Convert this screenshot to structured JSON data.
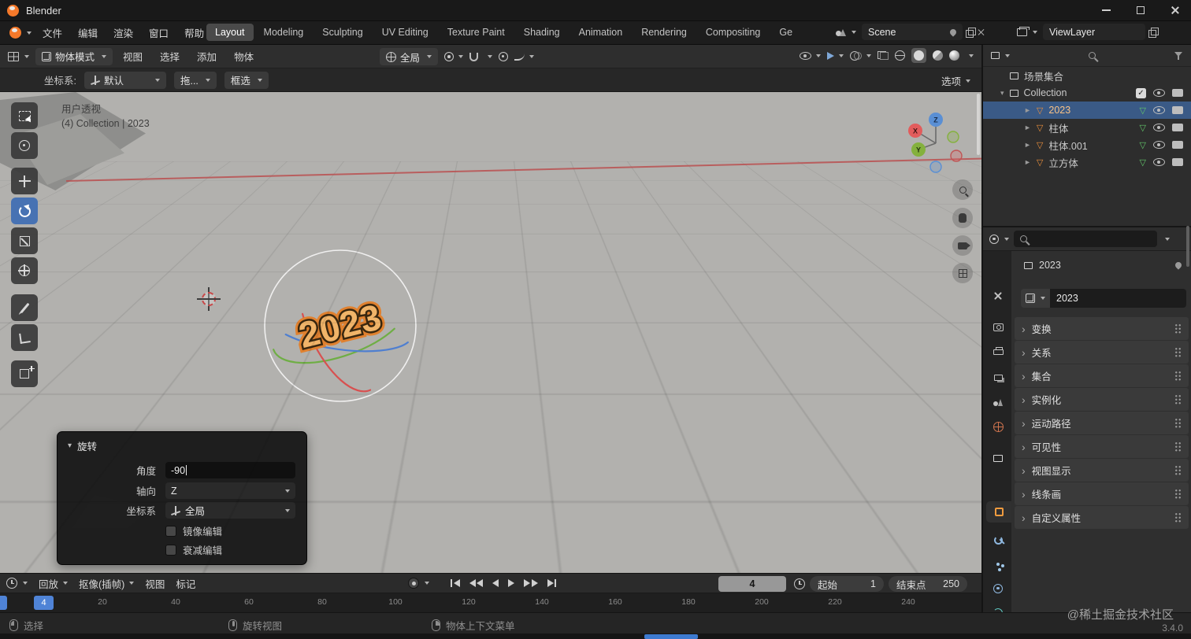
{
  "icons": {
    "mesh_tri": "▽",
    "chevron": "›",
    "collapse": "▾",
    "expand": "►"
  },
  "titlebar": {
    "title": "Blender"
  },
  "menubar": {
    "menus": [
      "文件",
      "编辑",
      "渲染",
      "窗口",
      "帮助"
    ],
    "workspaces": [
      "Layout",
      "Modeling",
      "Sculpting",
      "UV Editing",
      "Texture Paint",
      "Shading",
      "Animation",
      "Rendering",
      "Compositing",
      "Ge"
    ],
    "scene_value": "Scene",
    "viewlayer_value": "ViewLayer"
  },
  "viewport_header": {
    "mode": "物体模式",
    "menus": [
      "视图",
      "选择",
      "添加",
      "物体"
    ],
    "orientation": "全局"
  },
  "tool_header": {
    "label": "坐标系:",
    "preset": "默认",
    "drag": "拖...",
    "box_select": "框选",
    "options": "选项"
  },
  "viewport": {
    "view_label": "用户透视",
    "context_label": "(4) Collection | 2023",
    "object_text": "2023",
    "axes": {
      "x": "X",
      "y": "Y",
      "z": "Z"
    }
  },
  "rotate_panel": {
    "title": "旋转",
    "angle_label": "角度",
    "angle_value": "-90",
    "axis_label": "轴向",
    "axis_value": "Z",
    "orientation_label": "坐标系",
    "orientation_value": "全局",
    "mirror_label": "镜像编辑",
    "falloff_label": "衰减编辑"
  },
  "timeline": {
    "menus": [
      "回放",
      "抠像(插帧)",
      "视图",
      "标记"
    ],
    "current_frame": "4",
    "start_label": "起始",
    "start_value": "1",
    "end_label": "结束点",
    "end_value": "250",
    "ticks": [
      "20",
      "40",
      "60",
      "80",
      "100",
      "120",
      "140",
      "160",
      "180",
      "200",
      "220",
      "240"
    ]
  },
  "statusbar": {
    "hints": [
      "选择",
      "旋转视图",
      "物体上下文菜单"
    ],
    "watermark": "@稀土掘金技术社区",
    "version": "3.4.0"
  },
  "outliner": {
    "scene_collection": "场景集合",
    "collection": "Collection",
    "items": [
      {
        "name": "2023"
      },
      {
        "name": "柱体"
      },
      {
        "name": "柱体.001"
      },
      {
        "name": "立方体"
      }
    ]
  },
  "properties": {
    "breadcrumb": "2023",
    "object_name": "2023",
    "sections": [
      "变换",
      "关系",
      "集合",
      "实例化",
      "运动路径",
      "可见性",
      "视图显示",
      "线条画",
      "自定义属性"
    ]
  }
}
